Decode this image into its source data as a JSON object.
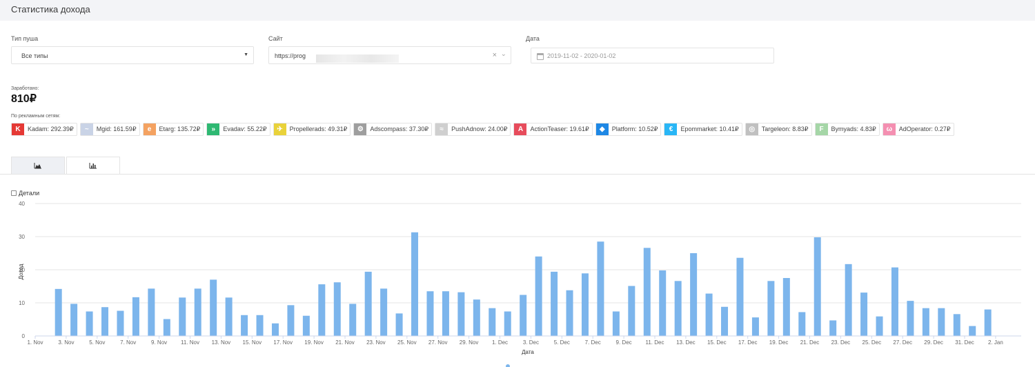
{
  "header": {
    "title": "Статистика дохода"
  },
  "filters": {
    "push_type": {
      "label": "Тип пуша",
      "value": "Все типы"
    },
    "site": {
      "label": "Сайт",
      "value": "https://prog"
    },
    "date": {
      "label": "Дата",
      "value": "2019-11-02 - 2020-01-02"
    }
  },
  "earned": {
    "label": "Заработано:",
    "value": "810₽"
  },
  "networks": {
    "label": "По рекламным сетям:",
    "items": [
      {
        "name": "Kadam: 292.39₽",
        "color": "#e53935",
        "glyph": "K"
      },
      {
        "name": "Mgid: 161.59₽",
        "color": "#c9d3e6",
        "glyph": "~"
      },
      {
        "name": "Etarg: 135.72₽",
        "color": "#f4a261",
        "glyph": "e"
      },
      {
        "name": "Evadav: 55.22₽",
        "color": "#2eb872",
        "glyph": "»"
      },
      {
        "name": "Propellerads: 49.31₽",
        "color": "#e9d23a",
        "glyph": "✈"
      },
      {
        "name": "Adscompass: 37.30₽",
        "color": "#9e9e9e",
        "glyph": "⚙"
      },
      {
        "name": "PushAdnow: 24.00₽",
        "color": "#cfcfcf",
        "glyph": "≈"
      },
      {
        "name": "ActionTeaser: 19.61₽",
        "color": "#e74c5c",
        "glyph": "A"
      },
      {
        "name": "Platform: 10.52₽",
        "color": "#1e88e5",
        "glyph": "◆"
      },
      {
        "name": "Epommarket: 10.41₽",
        "color": "#29b6f6",
        "glyph": "€"
      },
      {
        "name": "Targeleon: 8.83₽",
        "color": "#c0c0c0",
        "glyph": "◎"
      },
      {
        "name": "Bymyads: 4.83₽",
        "color": "#a5d6a7",
        "glyph": "F"
      },
      {
        "name": "AdOperator: 0.27₽",
        "color": "#f48fb1",
        "glyph": "ω"
      }
    ]
  },
  "details": {
    "label": "Детали"
  },
  "chart_data": {
    "type": "bar",
    "ylabel": "Доход",
    "xlabel": "Дата",
    "ylim": [
      0,
      40
    ],
    "yticks": [
      0,
      10,
      20,
      30,
      40
    ],
    "grid": true,
    "color": "#7cb5ec",
    "xticks": [
      "1. Nov",
      "3. Nov",
      "5. Nov",
      "7. Nov",
      "9. Nov",
      "11. Nov",
      "13. Nov",
      "15. Nov",
      "17. Nov",
      "19. Nov",
      "21. Nov",
      "23. Nov",
      "25. Nov",
      "27. Nov",
      "29. Nov",
      "1. Dec",
      "3. Dec",
      "5. Dec",
      "7. Dec",
      "9. Dec",
      "11. Dec",
      "13. Dec",
      "15. Dec",
      "17. Dec",
      "19. Dec",
      "21. Dec",
      "23. Dec",
      "25. Dec",
      "27. Dec",
      "29. Dec",
      "31. Dec",
      "2. Jan"
    ],
    "values": [
      14.2,
      9.7,
      7.4,
      8.7,
      7.6,
      11.7,
      14.3,
      5.1,
      11.6,
      14.3,
      17.0,
      11.6,
      6.3,
      6.3,
      3.8,
      9.3,
      6.1,
      15.6,
      16.2,
      9.7,
      19.4,
      14.3,
      6.8,
      31.3,
      13.5,
      13.5,
      13.2,
      11.0,
      8.4,
      7.4,
      12.4,
      24.0,
      19.4,
      13.8,
      18.9,
      28.5,
      7.4,
      15.1,
      26.6,
      19.8,
      16.6,
      25.0,
      12.8,
      8.8,
      23.6,
      5.6,
      16.6,
      17.5,
      7.2,
      29.8,
      4.7,
      21.7,
      13.1,
      5.9,
      20.7,
      10.6,
      8.4,
      8.4,
      6.6,
      3.0,
      8.0
    ]
  }
}
